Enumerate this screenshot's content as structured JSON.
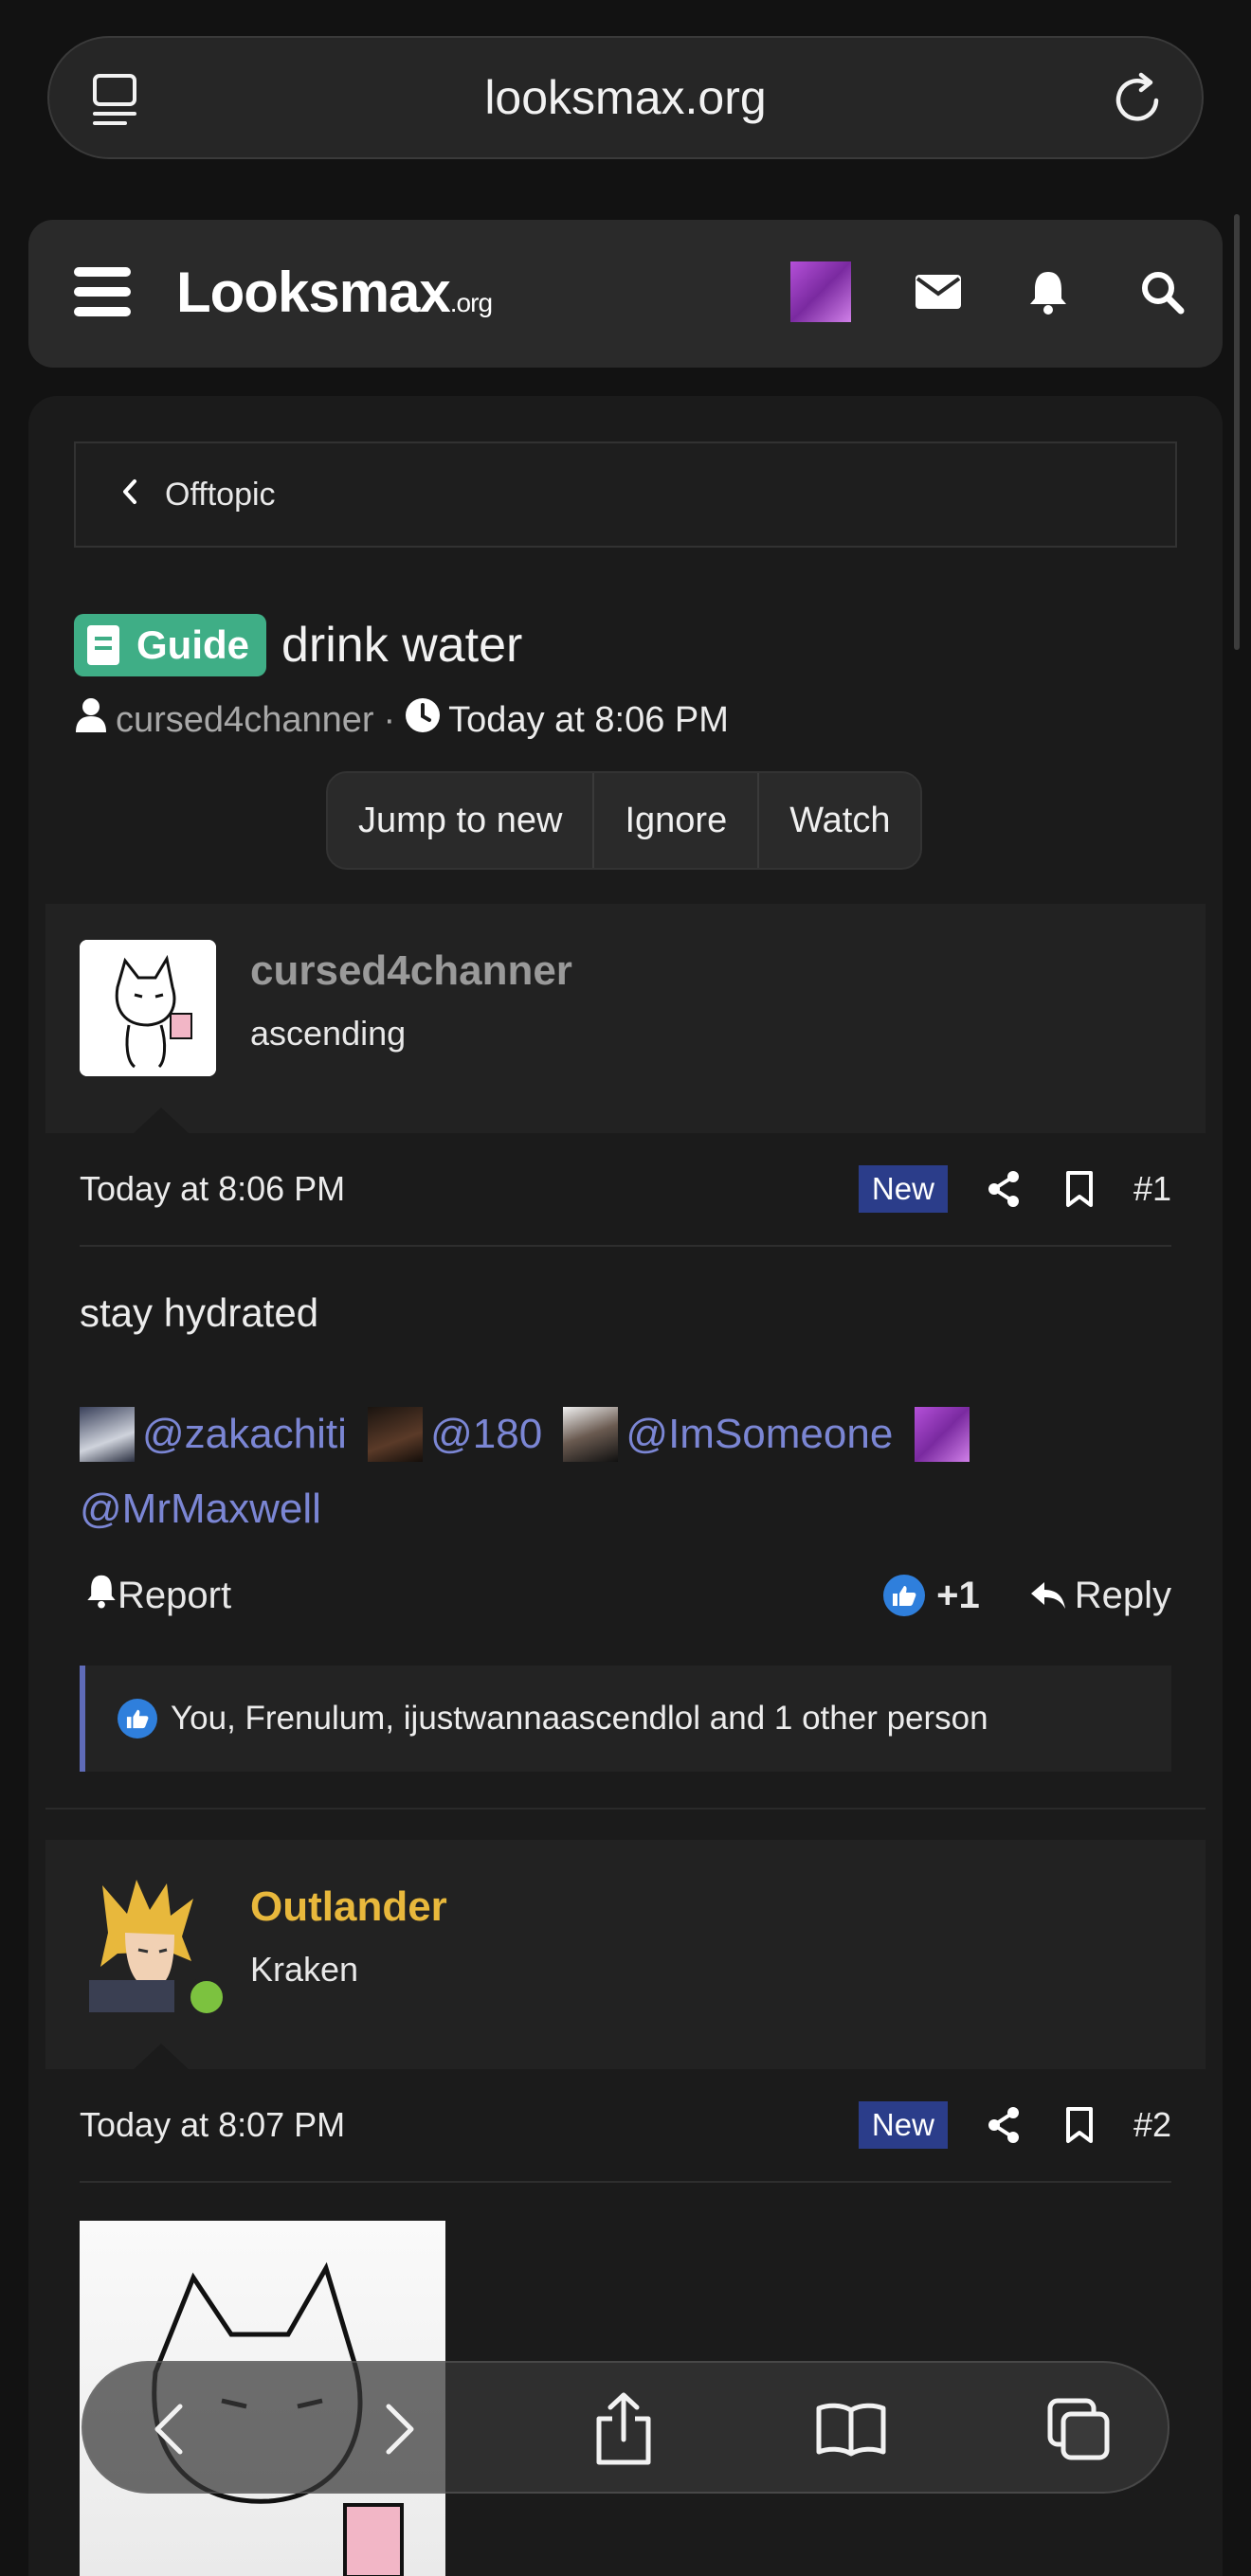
{
  "browser": {
    "url": "looksmax.org",
    "left_icon": "tab-overview-icon",
    "right_icon": "reload-icon"
  },
  "header": {
    "logo_main": "Looksmax",
    "logo_tld": ".org",
    "icons": [
      "menu-icon",
      "user-avatar",
      "envelope-icon",
      "bell-icon",
      "search-icon"
    ]
  },
  "breadcrumb": {
    "label": "Offtopic"
  },
  "thread": {
    "prefix": "Guide",
    "title": "drink water",
    "author": "cursed4channer",
    "separator": "·",
    "time": "Today at 8:06 PM",
    "buttons": {
      "jump": "Jump to new",
      "ignore": "Ignore",
      "watch": "Watch"
    }
  },
  "posts": [
    {
      "username": "cursed4channer",
      "user_title": "ascending",
      "username_color": "#9a9a9a",
      "time": "Today at 8:06 PM",
      "badge": "New",
      "number": "#1",
      "body": "stay hydrated",
      "mentions": [
        "@zakachiti",
        "@180",
        "@ImSomeone",
        "@MrMaxwell"
      ],
      "report": "Report",
      "likes": "+1",
      "reply": "Reply",
      "reactions": "You, Frenulum, ijustwannaascendlol and 1 other person"
    },
    {
      "username": "Outlander",
      "user_title": "Kraken",
      "username_color": "#e8b83c",
      "time": "Today at 8:07 PM",
      "badge": "New",
      "number": "#2"
    }
  ],
  "toolbar": {
    "icons": [
      "back-icon",
      "forward-icon",
      "share-icon",
      "bookmarks-icon",
      "tabs-icon"
    ]
  },
  "colors": {
    "accent_guide": "#3fae86",
    "mention": "#7b86d4",
    "new_badge": "#2b3d8a",
    "online": "#7cc23f"
  }
}
